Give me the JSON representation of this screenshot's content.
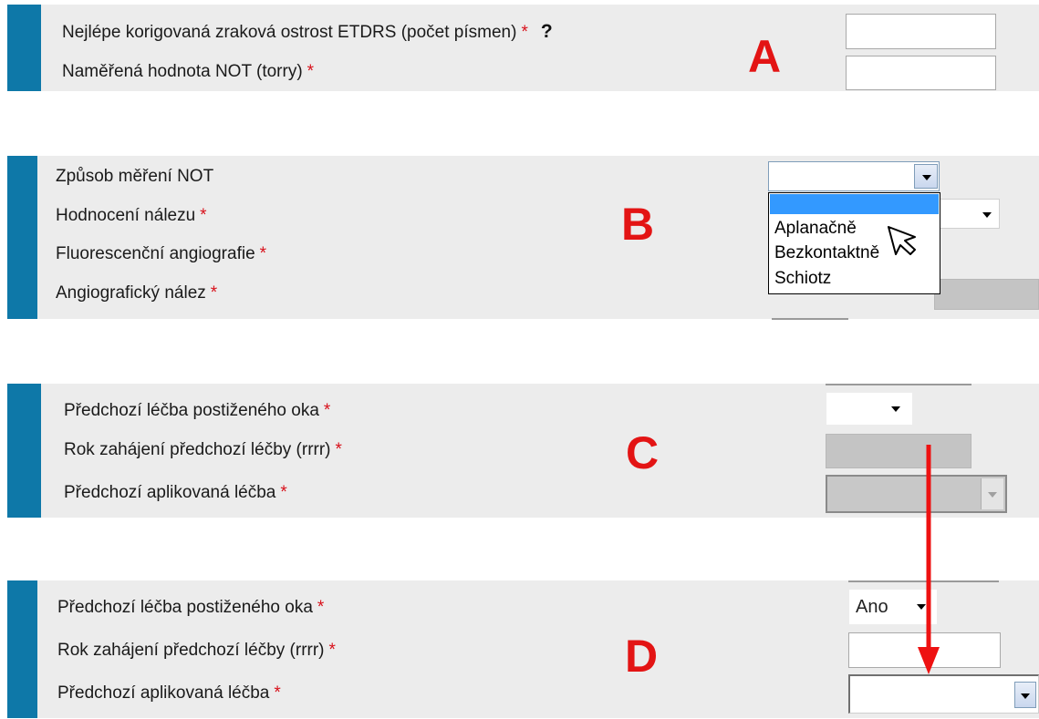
{
  "panel_a": {
    "letter": "A",
    "rows": [
      {
        "label": "Nejlépe korigovaná zraková ostrost ETDRS (počet písmen)",
        "required": "*",
        "help": "?"
      },
      {
        "label": "Naměřená hodnota NOT (torry)",
        "required": "*"
      }
    ]
  },
  "panel_b": {
    "letter": "B",
    "rows": [
      {
        "label": "Způsob měření NOT",
        "required": ""
      },
      {
        "label": "Hodnocení nálezu",
        "required": "*"
      },
      {
        "label": "Fluorescenční angiografie",
        "required": "*"
      },
      {
        "label": "Angiografický nález",
        "required": "*"
      }
    ],
    "dropdown_options": [
      "",
      "Aplanačně",
      "Bezkontaktně",
      "Schiotz"
    ],
    "dropdown_highlighted_index": 0,
    "cursor_icon": "mouse-pointer-icon"
  },
  "panel_c": {
    "letter": "C",
    "rows": [
      {
        "label": "Předchozí léčba postiženého oka",
        "required": "*"
      },
      {
        "label": "Rok zahájení předchozí léčby (rrrr)",
        "required": "*"
      },
      {
        "label": "Předchozí aplikovaná léčba",
        "required": "*"
      }
    ]
  },
  "panel_d": {
    "letter": "D",
    "rows": [
      {
        "label": "Předchozí léčba postiženého oka",
        "required": "*"
      },
      {
        "label": "Rok zahájení předchozí léčby (rrrr)",
        "required": "*"
      },
      {
        "label": "Předchozí aplikovaná léčba",
        "required": "*"
      }
    ],
    "select_value": "Ano"
  },
  "colors": {
    "accent_bar": "#0e78a8",
    "panel_bg": "#ececec",
    "required": "#d8101a",
    "annotation": "#e31414",
    "highlight": "#3399ff"
  },
  "annotation_arrow_icon": "red-arrow-down-icon"
}
